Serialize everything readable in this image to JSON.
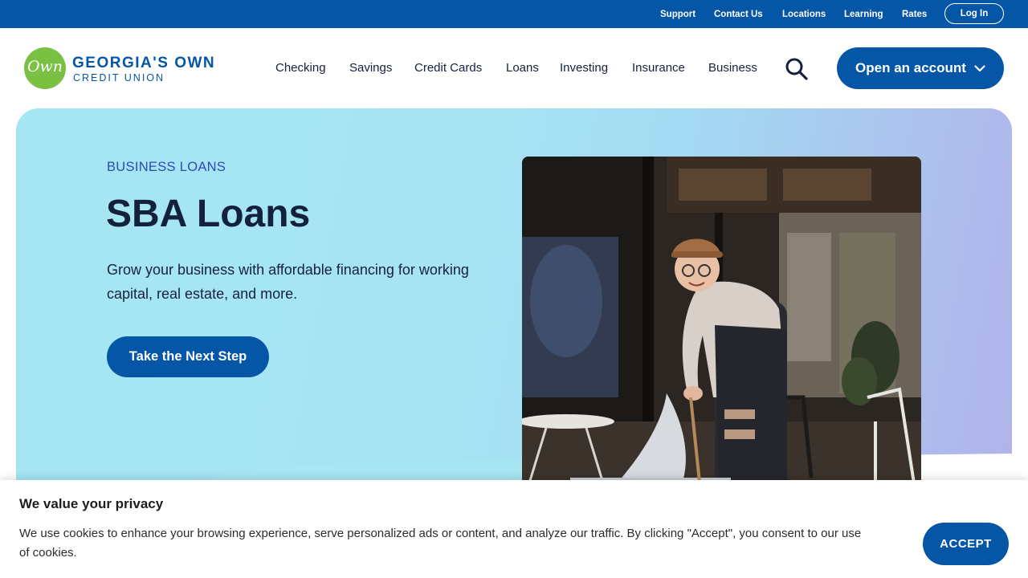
{
  "utility_nav": {
    "links": [
      "Support",
      "Contact Us",
      "Locations",
      "Learning",
      "Rates"
    ],
    "login_label": "Log In"
  },
  "brand": {
    "logo_mark": "Own",
    "name": "GEORGIA'S OWN",
    "subtitle": "CREDIT UNION",
    "green": "#7ac143",
    "blue": "#0556a6"
  },
  "main_nav": {
    "items": [
      "Checking",
      "Savings",
      "Credit Cards",
      "Loans",
      "Investing",
      "Insurance",
      "Business"
    ],
    "search_icon": "search-icon",
    "open_account_label": "Open an account",
    "open_account_icon": "chevron-down-icon"
  },
  "hero": {
    "eyebrow": "BUSINESS LOANS",
    "title": "SBA Loans",
    "description": "Grow your business with affordable financing for working capital, real estate, and more.",
    "cta_label": "Take the Next Step",
    "gradient_start": "#a6e6f3",
    "gradient_end": "#b0b2ea"
  },
  "cookie_banner": {
    "title": "We value your privacy",
    "text": "We use cookies to enhance your browsing experience, serve personalized ads or content, and analyze our traffic. By clicking \"Accept\", you consent to our use of cookies.",
    "accept_label": "ACCEPT"
  }
}
